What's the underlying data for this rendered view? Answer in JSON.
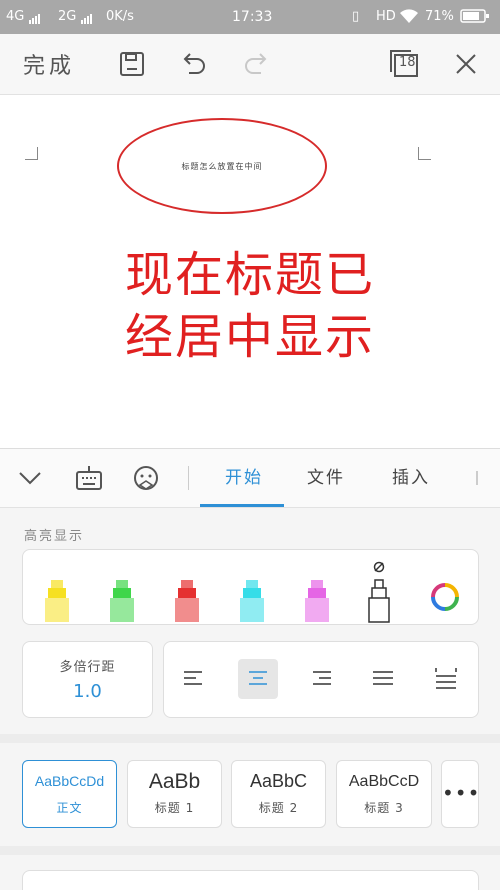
{
  "status_bar": {
    "network1": "4G",
    "network2": "2G",
    "speed": "0K/s",
    "time": "17:33",
    "hd": "HD",
    "battery": "71%"
  },
  "toolbar": {
    "done_label": "完成",
    "page_count": "18"
  },
  "document": {
    "header_text": "标题怎么放置在中间",
    "annotation_line1": "现在标题已",
    "annotation_line2": "经居中显示",
    "annotation_color": "#e02020"
  },
  "panel": {
    "tabs": [
      {
        "label": "开始",
        "active": true
      },
      {
        "label": "文件",
        "active": false
      },
      {
        "label": "插入",
        "active": false
      }
    ],
    "highlight_section_title": "高亮显示",
    "highlighter_colors": [
      "#f6e021",
      "#3fd64a",
      "#e53030",
      "#35dde8",
      "#e565e5"
    ],
    "line_spacing": {
      "label": "多倍行距",
      "value": "1.0"
    },
    "styles": [
      {
        "sample": "AaBbCcDd",
        "name": "正文",
        "selected": true
      },
      {
        "sample": "AaBb",
        "name": "标题 1",
        "selected": false
      },
      {
        "sample": "AaBbC",
        "name": "标题 2",
        "selected": false
      },
      {
        "sample": "AaBbCcD",
        "name": "标题 3",
        "selected": false
      }
    ],
    "accent_color": "#2e90d6"
  }
}
